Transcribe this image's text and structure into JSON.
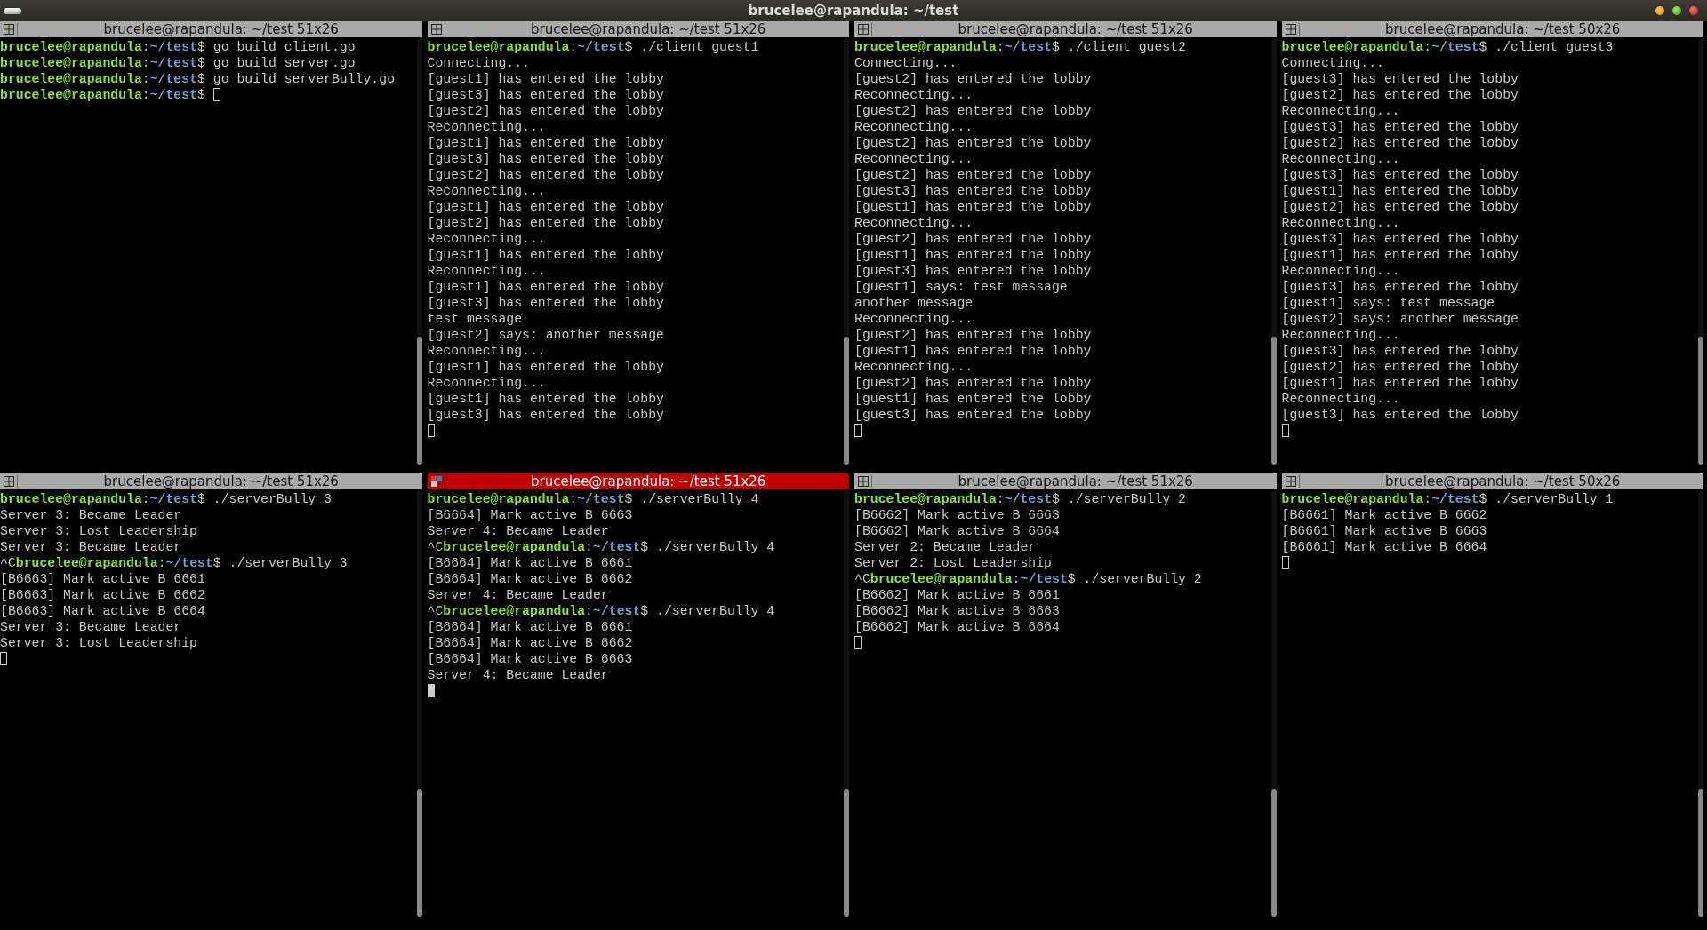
{
  "window": {
    "title": "brucelee@rapandula: ~/test"
  },
  "panes": [
    {
      "title": "brucelee@rapandula: ~/test 51x26",
      "focused": false,
      "lines": [
        {
          "kind": "prompt",
          "user": "brucelee@rapandula",
          "sep": ":",
          "path": "~/test",
          "tail": "$ go build client.go"
        },
        {
          "kind": "prompt",
          "user": "brucelee@rapandula",
          "sep": ":",
          "path": "~/test",
          "tail": "$ go build server.go"
        },
        {
          "kind": "prompt",
          "user": "brucelee@rapandula",
          "sep": ":",
          "path": "~/test",
          "tail": "$ go build serverBully.go"
        },
        {
          "kind": "prompt",
          "user": "brucelee@rapandula",
          "sep": ":",
          "path": "~/test",
          "tail": "$ ",
          "cursor": true
        }
      ]
    },
    {
      "title": "brucelee@rapandula: ~/test 51x26",
      "focused": false,
      "lines": [
        {
          "kind": "prompt",
          "user": "brucelee@rapandula",
          "sep": ":",
          "path": "~/test",
          "tail": "$ ./client guest1"
        },
        {
          "kind": "output",
          "text": "Connecting..."
        },
        {
          "kind": "output",
          "text": "[guest1] has entered the lobby"
        },
        {
          "kind": "output",
          "text": "[guest3] has entered the lobby"
        },
        {
          "kind": "output",
          "text": "[guest2] has entered the lobby"
        },
        {
          "kind": "output",
          "text": "Reconnecting..."
        },
        {
          "kind": "output",
          "text": "[guest1] has entered the lobby"
        },
        {
          "kind": "output",
          "text": "[guest3] has entered the lobby"
        },
        {
          "kind": "output",
          "text": "[guest2] has entered the lobby"
        },
        {
          "kind": "output",
          "text": "Reconnecting..."
        },
        {
          "kind": "output",
          "text": "[guest1] has entered the lobby"
        },
        {
          "kind": "output",
          "text": "[guest2] has entered the lobby"
        },
        {
          "kind": "output",
          "text": "Reconnecting..."
        },
        {
          "kind": "output",
          "text": "[guest1] has entered the lobby"
        },
        {
          "kind": "output",
          "text": "Reconnecting..."
        },
        {
          "kind": "output",
          "text": "[guest1] has entered the lobby"
        },
        {
          "kind": "output",
          "text": "[guest3] has entered the lobby"
        },
        {
          "kind": "output",
          "text": "test message"
        },
        {
          "kind": "output",
          "text": "[guest2] says: another message"
        },
        {
          "kind": "output",
          "text": "Reconnecting..."
        },
        {
          "kind": "output",
          "text": "[guest1] has entered the lobby"
        },
        {
          "kind": "output",
          "text": "Reconnecting..."
        },
        {
          "kind": "output",
          "text": "[guest1] has entered the lobby"
        },
        {
          "kind": "output",
          "text": "[guest3] has entered the lobby"
        },
        {
          "kind": "cursor"
        }
      ]
    },
    {
      "title": "brucelee@rapandula: ~/test 51x26",
      "focused": false,
      "lines": [
        {
          "kind": "prompt",
          "user": "brucelee@rapandula",
          "sep": ":",
          "path": "~/test",
          "tail": "$ ./client guest2"
        },
        {
          "kind": "output",
          "text": "Connecting..."
        },
        {
          "kind": "output",
          "text": "[guest2] has entered the lobby"
        },
        {
          "kind": "output",
          "text": "Reconnecting..."
        },
        {
          "kind": "output",
          "text": "[guest2] has entered the lobby"
        },
        {
          "kind": "output",
          "text": "Reconnecting..."
        },
        {
          "kind": "output",
          "text": "[guest2] has entered the lobby"
        },
        {
          "kind": "output",
          "text": "Reconnecting..."
        },
        {
          "kind": "output",
          "text": "[guest2] has entered the lobby"
        },
        {
          "kind": "output",
          "text": "[guest3] has entered the lobby"
        },
        {
          "kind": "output",
          "text": "[guest1] has entered the lobby"
        },
        {
          "kind": "output",
          "text": "Reconnecting..."
        },
        {
          "kind": "output",
          "text": "[guest2] has entered the lobby"
        },
        {
          "kind": "output",
          "text": "[guest1] has entered the lobby"
        },
        {
          "kind": "output",
          "text": "[guest3] has entered the lobby"
        },
        {
          "kind": "output",
          "text": "[guest1] says: test message"
        },
        {
          "kind": "output",
          "text": "another message"
        },
        {
          "kind": "output",
          "text": "Reconnecting..."
        },
        {
          "kind": "output",
          "text": "[guest2] has entered the lobby"
        },
        {
          "kind": "output",
          "text": "[guest1] has entered the lobby"
        },
        {
          "kind": "output",
          "text": "Reconnecting..."
        },
        {
          "kind": "output",
          "text": "[guest2] has entered the lobby"
        },
        {
          "kind": "output",
          "text": "[guest1] has entered the lobby"
        },
        {
          "kind": "output",
          "text": "[guest3] has entered the lobby"
        },
        {
          "kind": "cursor"
        }
      ]
    },
    {
      "title": "brucelee@rapandula: ~/test 50x26",
      "focused": false,
      "lines": [
        {
          "kind": "prompt",
          "user": "brucelee@rapandula",
          "sep": ":",
          "path": "~/test",
          "tail": "$ ./client guest3"
        },
        {
          "kind": "output",
          "text": "Connecting..."
        },
        {
          "kind": "output",
          "text": "[guest3] has entered the lobby"
        },
        {
          "kind": "output",
          "text": "[guest2] has entered the lobby"
        },
        {
          "kind": "output",
          "text": "Reconnecting..."
        },
        {
          "kind": "output",
          "text": "[guest3] has entered the lobby"
        },
        {
          "kind": "output",
          "text": "[guest2] has entered the lobby"
        },
        {
          "kind": "output",
          "text": "Reconnecting..."
        },
        {
          "kind": "output",
          "text": "[guest3] has entered the lobby"
        },
        {
          "kind": "output",
          "text": "[guest1] has entered the lobby"
        },
        {
          "kind": "output",
          "text": "[guest2] has entered the lobby"
        },
        {
          "kind": "output",
          "text": "Reconnecting..."
        },
        {
          "kind": "output",
          "text": "[guest3] has entered the lobby"
        },
        {
          "kind": "output",
          "text": "[guest1] has entered the lobby"
        },
        {
          "kind": "output",
          "text": "Reconnecting..."
        },
        {
          "kind": "output",
          "text": "[guest3] has entered the lobby"
        },
        {
          "kind": "output",
          "text": "[guest1] says: test message"
        },
        {
          "kind": "output",
          "text": "[guest2] says: another message"
        },
        {
          "kind": "output",
          "text": "Reconnecting..."
        },
        {
          "kind": "output",
          "text": "[guest3] has entered the lobby"
        },
        {
          "kind": "output",
          "text": "[guest2] has entered the lobby"
        },
        {
          "kind": "output",
          "text": "[guest1] has entered the lobby"
        },
        {
          "kind": "output",
          "text": "Reconnecting..."
        },
        {
          "kind": "output",
          "text": "[guest3] has entered the lobby"
        },
        {
          "kind": "cursor"
        }
      ]
    },
    {
      "title": "brucelee@rapandula: ~/test 51x26",
      "focused": false,
      "lines": [
        {
          "kind": "prompt",
          "user": "brucelee@rapandula",
          "sep": ":",
          "path": "~/test",
          "tail": "$ ./serverBully 3"
        },
        {
          "kind": "output",
          "text": "Server 3: Became Leader"
        },
        {
          "kind": "output",
          "text": "Server 3: Lost Leadership"
        },
        {
          "kind": "output",
          "text": "Server 3: Became Leader"
        },
        {
          "kind": "prompt",
          "prefix": "^C",
          "user": "brucelee@rapandula",
          "sep": ":",
          "path": "~/test",
          "tail": "$ ./serverBully 3"
        },
        {
          "kind": "output",
          "text": "[B6663] Mark active B 6661"
        },
        {
          "kind": "output",
          "text": "[B6663] Mark active B 6662"
        },
        {
          "kind": "output",
          "text": "[B6663] Mark active B 6664"
        },
        {
          "kind": "output",
          "text": "Server 3: Became Leader"
        },
        {
          "kind": "output",
          "text": "Server 3: Lost Leadership"
        },
        {
          "kind": "cursor"
        }
      ]
    },
    {
      "title": "brucelee@rapandula: ~/test 51x26",
      "focused": true,
      "lines": [
        {
          "kind": "prompt",
          "user": "brucelee@rapandula",
          "sep": ":",
          "path": "~/test",
          "tail": "$ ./serverBully 4"
        },
        {
          "kind": "output",
          "text": "[B6664] Mark active B 6663"
        },
        {
          "kind": "output",
          "text": "Server 4: Became Leader"
        },
        {
          "kind": "prompt",
          "prefix": "^C",
          "user": "brucelee@rapandula",
          "sep": ":",
          "path": "~/test",
          "tail": "$ ./serverBully 4"
        },
        {
          "kind": "output",
          "text": "[B6664] Mark active B 6661"
        },
        {
          "kind": "output",
          "text": "[B6664] Mark active B 6662"
        },
        {
          "kind": "output",
          "text": "Server 4: Became Leader"
        },
        {
          "kind": "prompt",
          "prefix": "^C",
          "user": "brucelee@rapandula",
          "sep": ":",
          "path": "~/test",
          "tail": "$ ./serverBully 4"
        },
        {
          "kind": "output",
          "text": "[B6664] Mark active B 6661"
        },
        {
          "kind": "output",
          "text": "[B6664] Mark active B 6662"
        },
        {
          "kind": "output",
          "text": "[B6664] Mark active B 6663"
        },
        {
          "kind": "output",
          "text": "Server 4: Became Leader"
        },
        {
          "kind": "cursor"
        }
      ]
    },
    {
      "title": "brucelee@rapandula: ~/test 51x26",
      "focused": false,
      "lines": [
        {
          "kind": "prompt",
          "user": "brucelee@rapandula",
          "sep": ":",
          "path": "~/test",
          "tail": "$ ./serverBully 2"
        },
        {
          "kind": "output",
          "text": "[B6662] Mark active B 6663"
        },
        {
          "kind": "output",
          "text": "[B6662] Mark active B 6664"
        },
        {
          "kind": "output",
          "text": "Server 2: Became Leader"
        },
        {
          "kind": "output",
          "text": "Server 2: Lost Leadership"
        },
        {
          "kind": "prompt",
          "prefix": "^C",
          "user": "brucelee@rapandula",
          "sep": ":",
          "path": "~/test",
          "tail": "$ ./serverBully 2"
        },
        {
          "kind": "output",
          "text": "[B6662] Mark active B 6661"
        },
        {
          "kind": "output",
          "text": "[B6662] Mark active B 6663"
        },
        {
          "kind": "output",
          "text": "[B6662] Mark active B 6664"
        },
        {
          "kind": "cursor"
        }
      ]
    },
    {
      "title": "brucelee@rapandula: ~/test 50x26",
      "focused": false,
      "lines": [
        {
          "kind": "prompt",
          "user": "brucelee@rapandula",
          "sep": ":",
          "path": "~/test",
          "tail": "$ ./serverBully 1"
        },
        {
          "kind": "output",
          "text": "[B6661] Mark active B 6662"
        },
        {
          "kind": "output",
          "text": "[B6661] Mark active B 6663"
        },
        {
          "kind": "output",
          "text": "[B6661] Mark active B 6664"
        },
        {
          "kind": "cursor"
        }
      ]
    }
  ]
}
